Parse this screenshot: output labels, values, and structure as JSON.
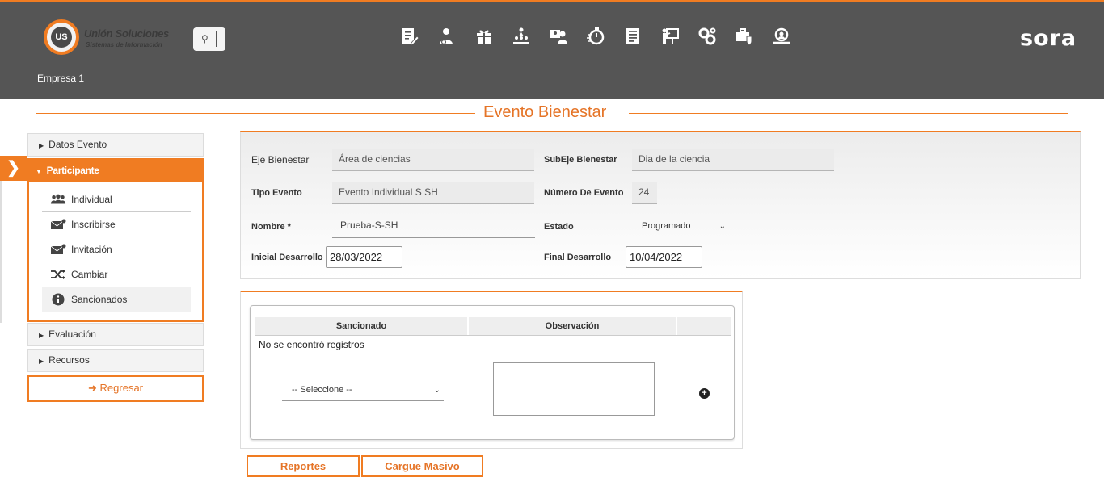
{
  "header": {
    "logo_name": "Unión Soluciones",
    "logo_sub": "Sistemas de Información",
    "logo_initials": "US",
    "brand": "sora",
    "company": "Empresa 1",
    "module_icons": [
      "document-edit-icon",
      "user-settings-icon",
      "gift-icon",
      "hierarchy-icon",
      "user-card-icon",
      "timer-icon",
      "report-list-icon",
      "presentation-icon",
      "gears-icon",
      "briefcase-shield-icon",
      "user-search-icon"
    ]
  },
  "page": {
    "title": "Evento Bienestar"
  },
  "sidebar": {
    "items_top": [
      {
        "label": "Datos Evento"
      }
    ],
    "open_section": "Participante",
    "sub_items": [
      {
        "label": "Individual",
        "icon": "people-icon"
      },
      {
        "label": "Inscribirse",
        "icon": "envelope-icon"
      },
      {
        "label": "Invitación",
        "icon": "envelope-icon"
      },
      {
        "label": "Cambiar",
        "icon": "shuffle-icon"
      },
      {
        "label": "Sancionados",
        "icon": "info-icon"
      }
    ],
    "items_bottom": [
      {
        "label": "Evaluación"
      },
      {
        "label": "Recursos"
      }
    ],
    "back_label": "Regresar"
  },
  "form": {
    "eje_label": "Eje Bienestar",
    "eje_value": "Área de ciencias",
    "subeje_label": "SubEje Bienestar",
    "subeje_value": "Dia de la ciencia",
    "tipo_label": "Tipo Evento",
    "tipo_value": "Evento Individual S SH",
    "numero_label": "Número De Evento",
    "numero_value": "24",
    "nombre_label": "Nombre *",
    "nombre_value": "Prueba-S-SH",
    "estado_label": "Estado",
    "estado_value": "Programado",
    "inicial_label": "Inicial Desarrollo",
    "inicial_value": "28/03/2022",
    "final_label": "Final Desarrollo",
    "final_value": "10/04/2022"
  },
  "grid": {
    "columns": [
      "Sancionado",
      "Observación"
    ],
    "empty_message": "No se encontró registros",
    "select_value": "-- Seleccione --"
  },
  "actions": {
    "reportes_label": "Reportes",
    "cargue_label": "Cargue Masivo"
  },
  "colors": {
    "accent": "#f07c22",
    "header_bg": "#555555",
    "title": "#e57427"
  }
}
